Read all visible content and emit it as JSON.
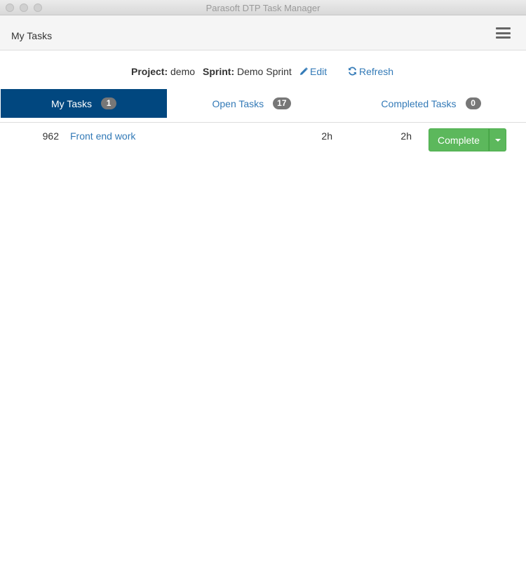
{
  "window": {
    "title": "Parasoft DTP Task Manager"
  },
  "navbar": {
    "title": "My Tasks",
    "menu_icon": "hamburger-menu-icon"
  },
  "project_bar": {
    "project_label": "Project:",
    "project_value": "demo",
    "sprint_label": "Sprint:",
    "sprint_value": "Demo Sprint",
    "edit_label": "Edit",
    "edit_icon": "pencil-icon",
    "refresh_label": "Refresh",
    "refresh_icon": "refresh-icon"
  },
  "tabs": [
    {
      "label": "My Tasks",
      "count": "1",
      "active": true
    },
    {
      "label": "Open Tasks",
      "count": "17",
      "active": false
    },
    {
      "label": "Completed Tasks",
      "count": "0",
      "active": false
    }
  ],
  "tasks": [
    {
      "id": "962",
      "name": "Front end work",
      "estimate": "2h",
      "remaining": "2h",
      "action_label": "Complete"
    }
  ],
  "colors": {
    "active_tab": "#01477f",
    "link": "#337ab7",
    "success_button": "#5cb85c",
    "badge": "#777777"
  }
}
